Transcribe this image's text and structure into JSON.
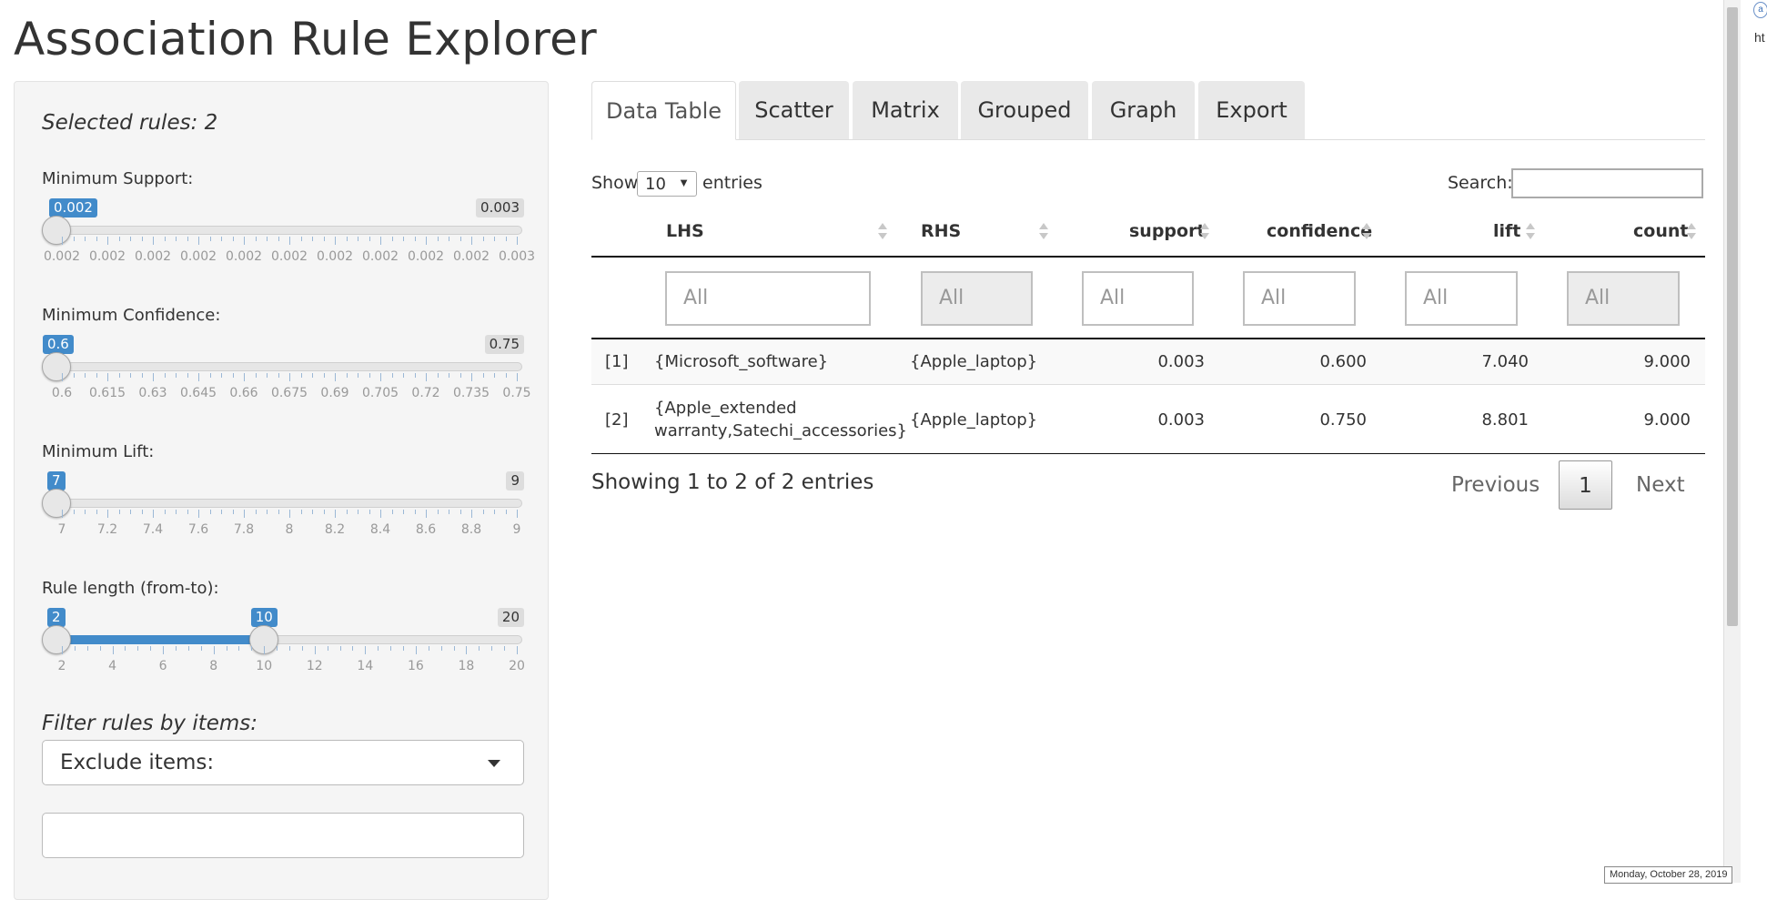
{
  "app": {
    "title": "Association Rule Explorer"
  },
  "sidebar": {
    "selected_rules": "Selected rules: 2",
    "sliders": [
      {
        "label": "Minimum Support:",
        "from_label": "0.002",
        "max_label": "0.003",
        "value_fraction": 0.0,
        "ticks": [
          "0.002",
          "0.002",
          "0.002",
          "0.002",
          "0.002",
          "0.002",
          "0.002",
          "0.002",
          "0.002",
          "0.002",
          "0.003"
        ]
      },
      {
        "label": "Minimum Confidence:",
        "from_label": "0.6",
        "max_label": "0.75",
        "value_fraction": 0.0,
        "ticks": [
          "0.6",
          "0.615",
          "0.63",
          "0.645",
          "0.66",
          "0.675",
          "0.69",
          "0.705",
          "0.72",
          "0.735",
          "0.75"
        ]
      },
      {
        "label": "Minimum Lift:",
        "from_label": "7",
        "max_label": "9",
        "value_fraction": 0.0,
        "ticks": [
          "7",
          "7.2",
          "7.4",
          "7.6",
          "7.8",
          "8",
          "8.2",
          "8.4",
          "8.6",
          "8.8",
          "9"
        ]
      },
      {
        "label": "Rule length (from-to):",
        "from_label": "2",
        "to_label": "10",
        "max_label": "20",
        "range": {
          "from": 2,
          "to": 10,
          "min": 2,
          "max": 20
        },
        "ticks": [
          "2",
          "4",
          "6",
          "8",
          "10",
          "12",
          "14",
          "16",
          "18",
          "20"
        ]
      }
    ],
    "filter_title": "Filter rules by items:",
    "filter_mode": "Exclude items:",
    "filter_items_value": ""
  },
  "tabs": [
    "Data Table",
    "Scatter",
    "Matrix",
    "Grouped",
    "Graph",
    "Export"
  ],
  "active_tab": "Data Table",
  "table_controls": {
    "show_label": "Show",
    "page_length": "10",
    "entries_label": "entries",
    "search_label": "Search:",
    "search_value": ""
  },
  "table": {
    "columns": [
      "LHS",
      "RHS",
      "support",
      "confidence",
      "lift",
      "count"
    ],
    "filter_placeholder": "All",
    "rows": [
      {
        "index": "[1]",
        "lhs": "{Microsoft_software}",
        "lhs2": "",
        "rhs": "{Apple_laptop}",
        "support": "0.003",
        "confidence": "0.600",
        "lift": "7.040",
        "count": "9.000"
      },
      {
        "index": "[2]",
        "lhs": "{Apple_extended",
        "lhs2": "warranty,Satechi_accessories}",
        "rhs": "{Apple_laptop}",
        "support": "0.003",
        "confidence": "0.750",
        "lift": "8.801",
        "count": "9.000"
      }
    ]
  },
  "info": "Showing 1 to 2 of 2 entries",
  "pagination": {
    "previous": "Previous",
    "current": "1",
    "next": "Next"
  },
  "edge": {
    "text": "ht",
    "badge": "a"
  },
  "date": "Monday, October 28, 2019",
  "colors": {
    "accent": "#428bca",
    "track": "#e6e6e6",
    "panel": "#f5f5f5"
  }
}
